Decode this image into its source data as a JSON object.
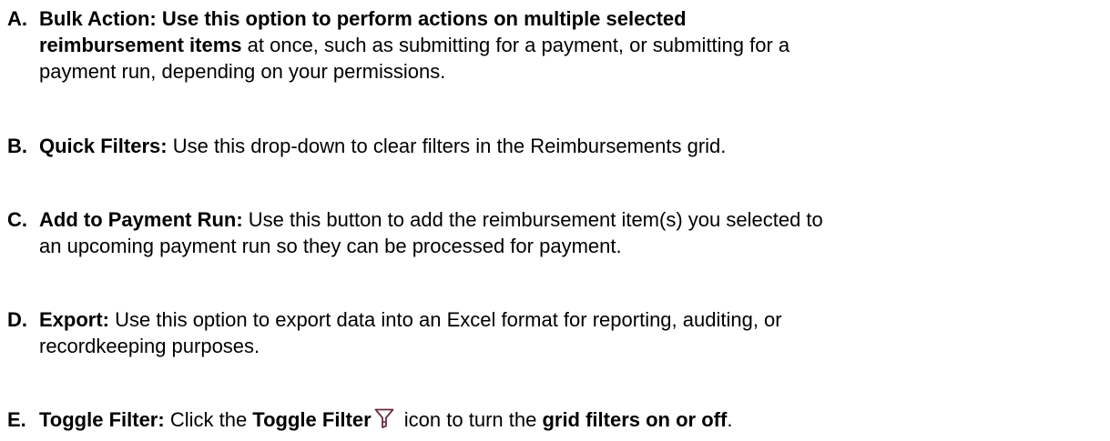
{
  "items": [
    {
      "marker": "A.",
      "line1_bold": "Bulk Action: Use this option to perform actions on multiple selected",
      "line2_bold": "reimbursement items",
      "line2_rest": " at once, such as submitting for a payment, or submitting for a",
      "line3": "payment run, depending on your permissions."
    },
    {
      "marker": "B.",
      "term": "Quick Filters:",
      "desc": " Use this drop-down to clear filters in the Reimbursements grid."
    },
    {
      "marker": "C.",
      "term": "Add to Payment Run:",
      "desc": " Use this button to add the reimbursement item(s) you selected to",
      "line2": "an upcoming payment run so they can be processed for payment."
    },
    {
      "marker": "D.",
      "term": "Export:",
      "desc": " Use this option to export data into an Excel format for reporting, auditing, or",
      "line2": "recordkeeping purposes."
    },
    {
      "marker": "E.",
      "term": "Toggle Filter:",
      "t1": " Click the ",
      "t2": "Toggle Filter",
      "t3": " icon to turn the ",
      "t4": "grid filters on or off",
      "t5": ".",
      "icon": "funnel-filter-icon",
      "icon_color": "#6b2d3b"
    }
  ]
}
